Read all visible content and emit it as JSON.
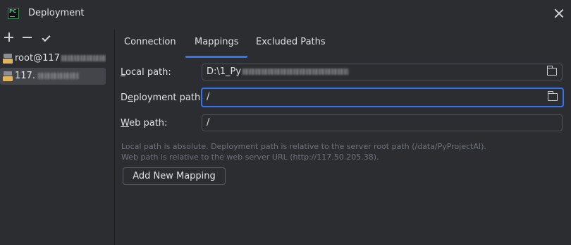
{
  "window": {
    "title": "Deployment",
    "logo_text": "PC"
  },
  "toolbar": {
    "add": "add-icon",
    "remove": "minus-icon",
    "apply": "check-icon"
  },
  "servers": [
    {
      "prefix": "root@117",
      "icon": "sftp-icon",
      "selected": false
    },
    {
      "prefix": "117.",
      "icon": "sftp-icon",
      "selected": true
    }
  ],
  "tabs": [
    {
      "label": "Connection",
      "active": false
    },
    {
      "label": "Mappings",
      "active": true
    },
    {
      "label": "Excluded Paths",
      "active": false
    }
  ],
  "form": {
    "local_path": {
      "label_mnemonic": "L",
      "label_rest": "ocal path:",
      "value_prefix": "D:\\1_Py"
    },
    "deployment_path": {
      "label_before": "D",
      "label_mnemonic": "e",
      "label_rest": "ployment path:",
      "value": "/"
    },
    "web_path": {
      "label_mnemonic": "W",
      "label_rest": "eb path:",
      "value": "/"
    }
  },
  "hints": {
    "line1": "Local path is absolute. Deployment path is relative to the server root path (/data/PyProjectAI).",
    "line2": "Web path is relative to the web server URL (http://117.50.205.38)."
  },
  "add_mapping_label": "Add New Mapping",
  "accent_color": "#3574f0"
}
